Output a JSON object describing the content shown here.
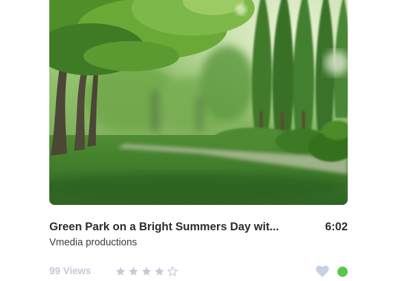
{
  "video": {
    "title": "Green Park on a Bright Summers Day wit...",
    "duration": "6:02",
    "channel": "Vmedia productions",
    "views": "99 Views",
    "rating": 4,
    "rating_max": 5
  },
  "icons": {
    "favorite": "heart-icon",
    "status": "online-status-dot",
    "rating_star": "star-icon"
  },
  "colors": {
    "title_text": "#2a2c31",
    "muted_text": "#c3cad8",
    "star_fill": "#c3cad8",
    "heart_fill": "#c6d1e4",
    "status_online": "#57c84d",
    "foliage": "#5a9a2c",
    "grass": "#3f7b2a"
  }
}
